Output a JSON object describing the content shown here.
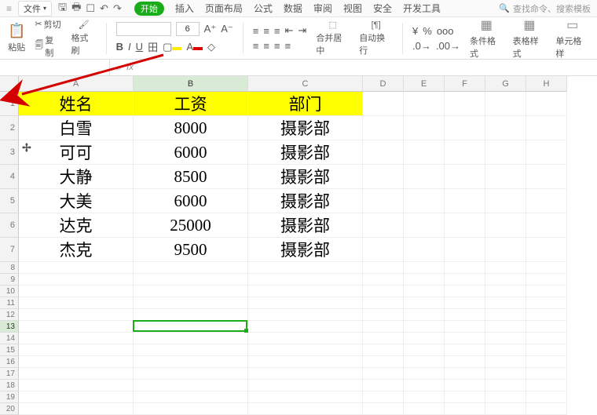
{
  "menu": {
    "file_label": "文件",
    "tabs": {
      "start": "开始",
      "insert": "插入",
      "layout": "页面布局",
      "formula": "公式",
      "data": "数据",
      "review": "审阅",
      "view": "视图",
      "security": "安全",
      "dev": "开发工具",
      "search": "查找命令、搜索模板"
    }
  },
  "ribbon": {
    "paste": "粘贴",
    "cut": "剪切",
    "copy": "复制",
    "format_painter": "格式刷",
    "font_size": "6",
    "merge_center": "合并居中",
    "wrap": "自动换行",
    "cond_format": "条件格式",
    "table_style": "表格样式",
    "cell_style": "单元格样"
  },
  "formula_bar": {
    "fx": "fx"
  },
  "columns": [
    "A",
    "B",
    "C",
    "D",
    "E",
    "F",
    "G",
    "H"
  ],
  "col_widths_wide": [
    146,
    146,
    146
  ],
  "col_width_narrow": 52,
  "row_count_visible": 20,
  "tall_rows": [
    1,
    2,
    3,
    4,
    5,
    6,
    7
  ],
  "header_row": [
    "姓名",
    "工资",
    "部门"
  ],
  "data_rows": [
    {
      "name": "白雪",
      "salary": "8000",
      "dept": "摄影部"
    },
    {
      "name": "可可",
      "salary": "6000",
      "dept": "摄影部"
    },
    {
      "name": "大静",
      "salary": "8500",
      "dept": "摄影部"
    },
    {
      "name": "大美",
      "salary": "6000",
      "dept": "摄影部"
    },
    {
      "name": "达克",
      "salary": "25000",
      "dept": "摄影部"
    },
    {
      "name": "杰克",
      "salary": "9500",
      "dept": "摄影部"
    }
  ],
  "active_cell": {
    "col": "B",
    "row": 13
  },
  "cursor_at": {
    "desc": "plus-cursor near A3"
  }
}
